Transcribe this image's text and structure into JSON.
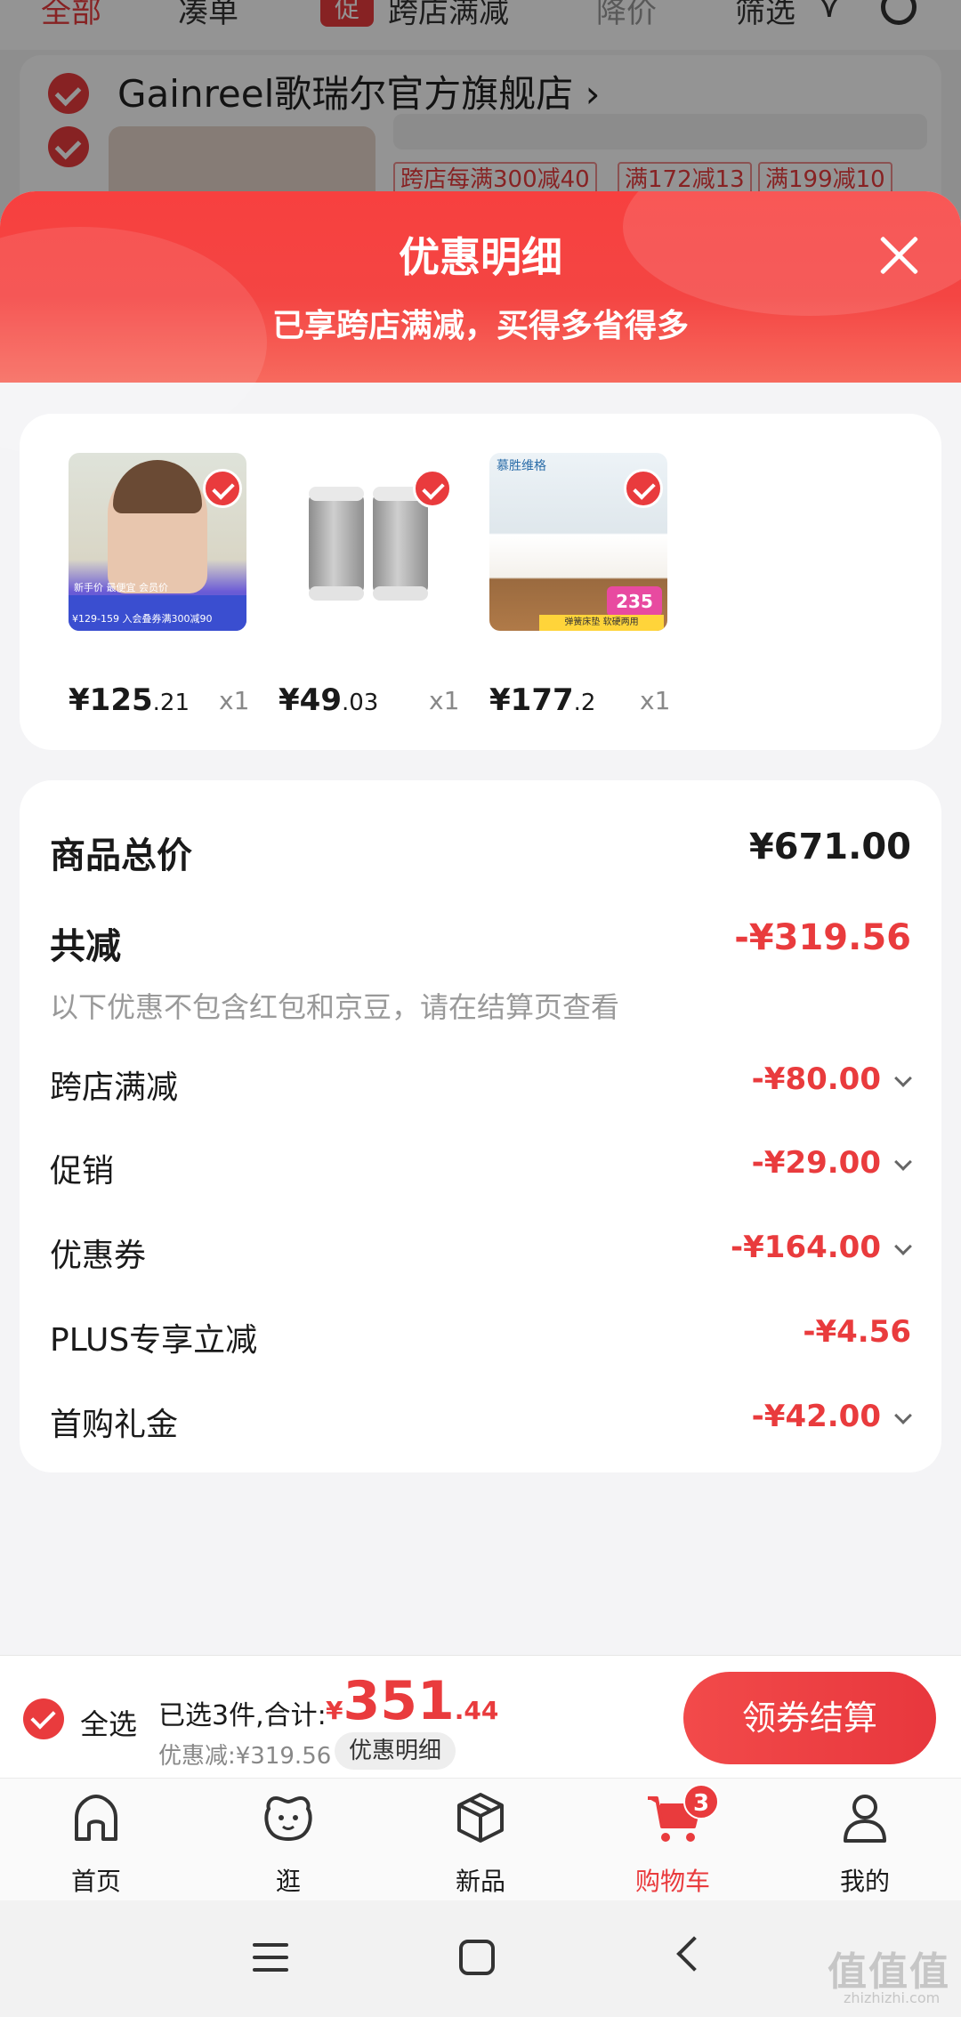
{
  "background": {
    "tabs": [
      "全部",
      "凑单",
      "跨店满减",
      "降价",
      "筛选"
    ],
    "tab_tag": "促",
    "store_name": "Gainreel歌瑞尔官方旗舰店 ›",
    "promo_chips": [
      "跨店每满300减40",
      "满172减13",
      "满199减10"
    ]
  },
  "sheet": {
    "title": "优惠明细",
    "subtitle": "已享跨店满减，买得多省得多",
    "products": [
      {
        "icon": "bra-product-image",
        "price_int": "¥125",
        "price_dec": ".21",
        "qty": "x1",
        "img_text_1": "新手价  最便宜 会员价",
        "img_text_2": "¥129-159  入会叠券满300减90"
      },
      {
        "icon": "filter-cartridge-image",
        "price_int": "¥49",
        "price_dec": ".03",
        "qty": "x1"
      },
      {
        "icon": "mattress-image",
        "price_int": "¥177",
        "price_dec": ".2",
        "qty": "x1",
        "img_brand": "慕胜维格",
        "img_badge": "235",
        "img_strip": "弹簧床垫 软硬两用"
      }
    ],
    "summary": {
      "total_label": "商品总价",
      "total_value": "¥671.00",
      "reduce_label": "共减",
      "reduce_value": "-¥319.56",
      "note": "以下优惠不包含红包和京豆，请在结算页查看",
      "items": [
        {
          "label": "跨店满减",
          "value": "-¥80.00",
          "expandable": true
        },
        {
          "label": "促销",
          "value": "-¥29.00",
          "expandable": true
        },
        {
          "label": "优惠券",
          "value": "-¥164.00",
          "expandable": true
        },
        {
          "label": "PLUS专享立减",
          "value": "-¥4.56",
          "expandable": false
        },
        {
          "label": "首购礼金",
          "value": "-¥42.00",
          "expandable": true
        }
      ]
    }
  },
  "checkout": {
    "select_all": "全选",
    "selected_count": "已选3件,合计:",
    "total_currency": "¥",
    "total_int": "351",
    "total_dec": ".44",
    "discount_line": "优惠减:¥319.56",
    "detail_button": "优惠明细",
    "checkout_button": "领券结算"
  },
  "tabbar": {
    "items": [
      {
        "label": "首页",
        "icon": "home-icon"
      },
      {
        "label": "逛",
        "icon": "explore-icon"
      },
      {
        "label": "新品",
        "icon": "new-products-icon"
      },
      {
        "label": "购物车",
        "icon": "cart-icon",
        "badge": "3",
        "active": true
      },
      {
        "label": "我的",
        "icon": "profile-icon"
      }
    ]
  },
  "watermark": {
    "text": "值值值",
    "url": "zhizhizhi.com"
  },
  "colors": {
    "accent": "#e93b3d",
    "header_gradient_top": "#f7403f",
    "background": "#f4f4f6"
  }
}
